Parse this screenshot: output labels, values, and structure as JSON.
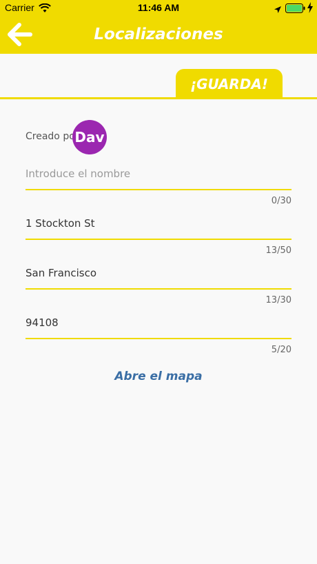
{
  "status_bar": {
    "carrier": "Carrier",
    "time": "11:46 AM"
  },
  "nav": {
    "title": "Localizaciones",
    "back_icon": "arrow-left-icon"
  },
  "tabs": {
    "save_label": "¡GUARDA!"
  },
  "creator": {
    "label": "Creado por:",
    "avatar_text": "Dav",
    "avatar_color": "#9b27b0"
  },
  "fields": [
    {
      "value": "",
      "placeholder": "Introduce el nombre",
      "counter": "0/30"
    },
    {
      "value": "1 Stockton St",
      "placeholder": "",
      "counter": "13/50"
    },
    {
      "value": "San Francisco",
      "placeholder": "",
      "counter": "13/30"
    },
    {
      "value": "94108",
      "placeholder": "",
      "counter": "5/20"
    }
  ],
  "map_link": "Abre el mapa",
  "colors": {
    "accent": "#f0db00",
    "link": "#3a6ea5"
  }
}
